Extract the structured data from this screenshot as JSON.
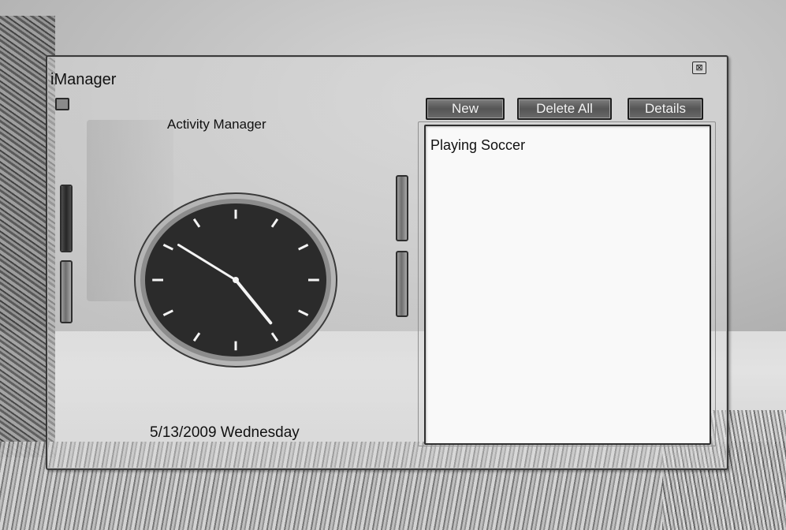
{
  "window": {
    "app_title": "iManager",
    "close_glyph": "⊠",
    "heading": "Activity Manager",
    "date_text": "5/13/2009 Wednesday"
  },
  "clock": {
    "hour": 4,
    "minute": 51,
    "face_color": "#2b2b2b",
    "rim_color": "#8c8c8c",
    "hand_color": "#f4f4f4"
  },
  "sliders": {
    "left_top_level": 1.0,
    "left_bottom_level": 0.0,
    "right_top_level": 0.0,
    "right_bottom_level": 0.0
  },
  "toolbar": {
    "new_label": "New",
    "delete_all_label": "Delete All",
    "details_label": "Details"
  },
  "activities": {
    "items": [
      "Playing Soccer"
    ]
  },
  "icons": {
    "close": "close-icon",
    "menu": "menu-icon"
  }
}
